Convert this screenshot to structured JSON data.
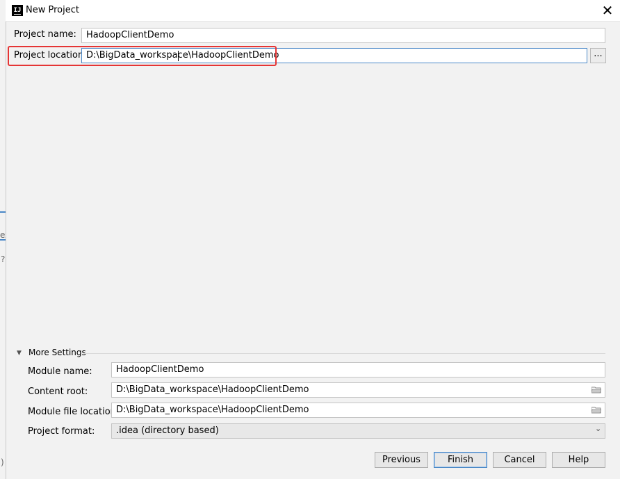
{
  "window": {
    "title": "New Project",
    "app_icon_text": "IJ",
    "close_glyph": "✕"
  },
  "form": {
    "project_name_label": "Project name:",
    "project_name_value": "HadoopClientDemo",
    "project_location_label": "Project location:",
    "project_location_value": "D:\\BigData_workspace\\HadoopClientDemo",
    "browse_label": "..."
  },
  "more_settings": {
    "toggle_glyph": "▼",
    "title": "More Settings",
    "module_name_label": "Module name:",
    "module_name_value": "HadoopClientDemo",
    "content_root_label": "Content root:",
    "content_root_value": "D:\\BigData_workspace\\HadoopClientDemo",
    "module_file_location_label": "Module file location:",
    "module_file_location_value": "D:\\BigData_workspace\\HadoopClientDemo",
    "project_format_label": "Project format:",
    "project_format_value": ".idea (directory based)",
    "chevron_glyph": "⌄"
  },
  "buttons": {
    "previous": "Previous",
    "finish": "Finish",
    "cancel": "Cancel",
    "help": "Help"
  },
  "background": {
    "frag_1": "ex",
    "frag_2": "?",
    "frag_3": ")"
  },
  "colors": {
    "accent": "#4a88c7",
    "highlight": "#e53535"
  }
}
